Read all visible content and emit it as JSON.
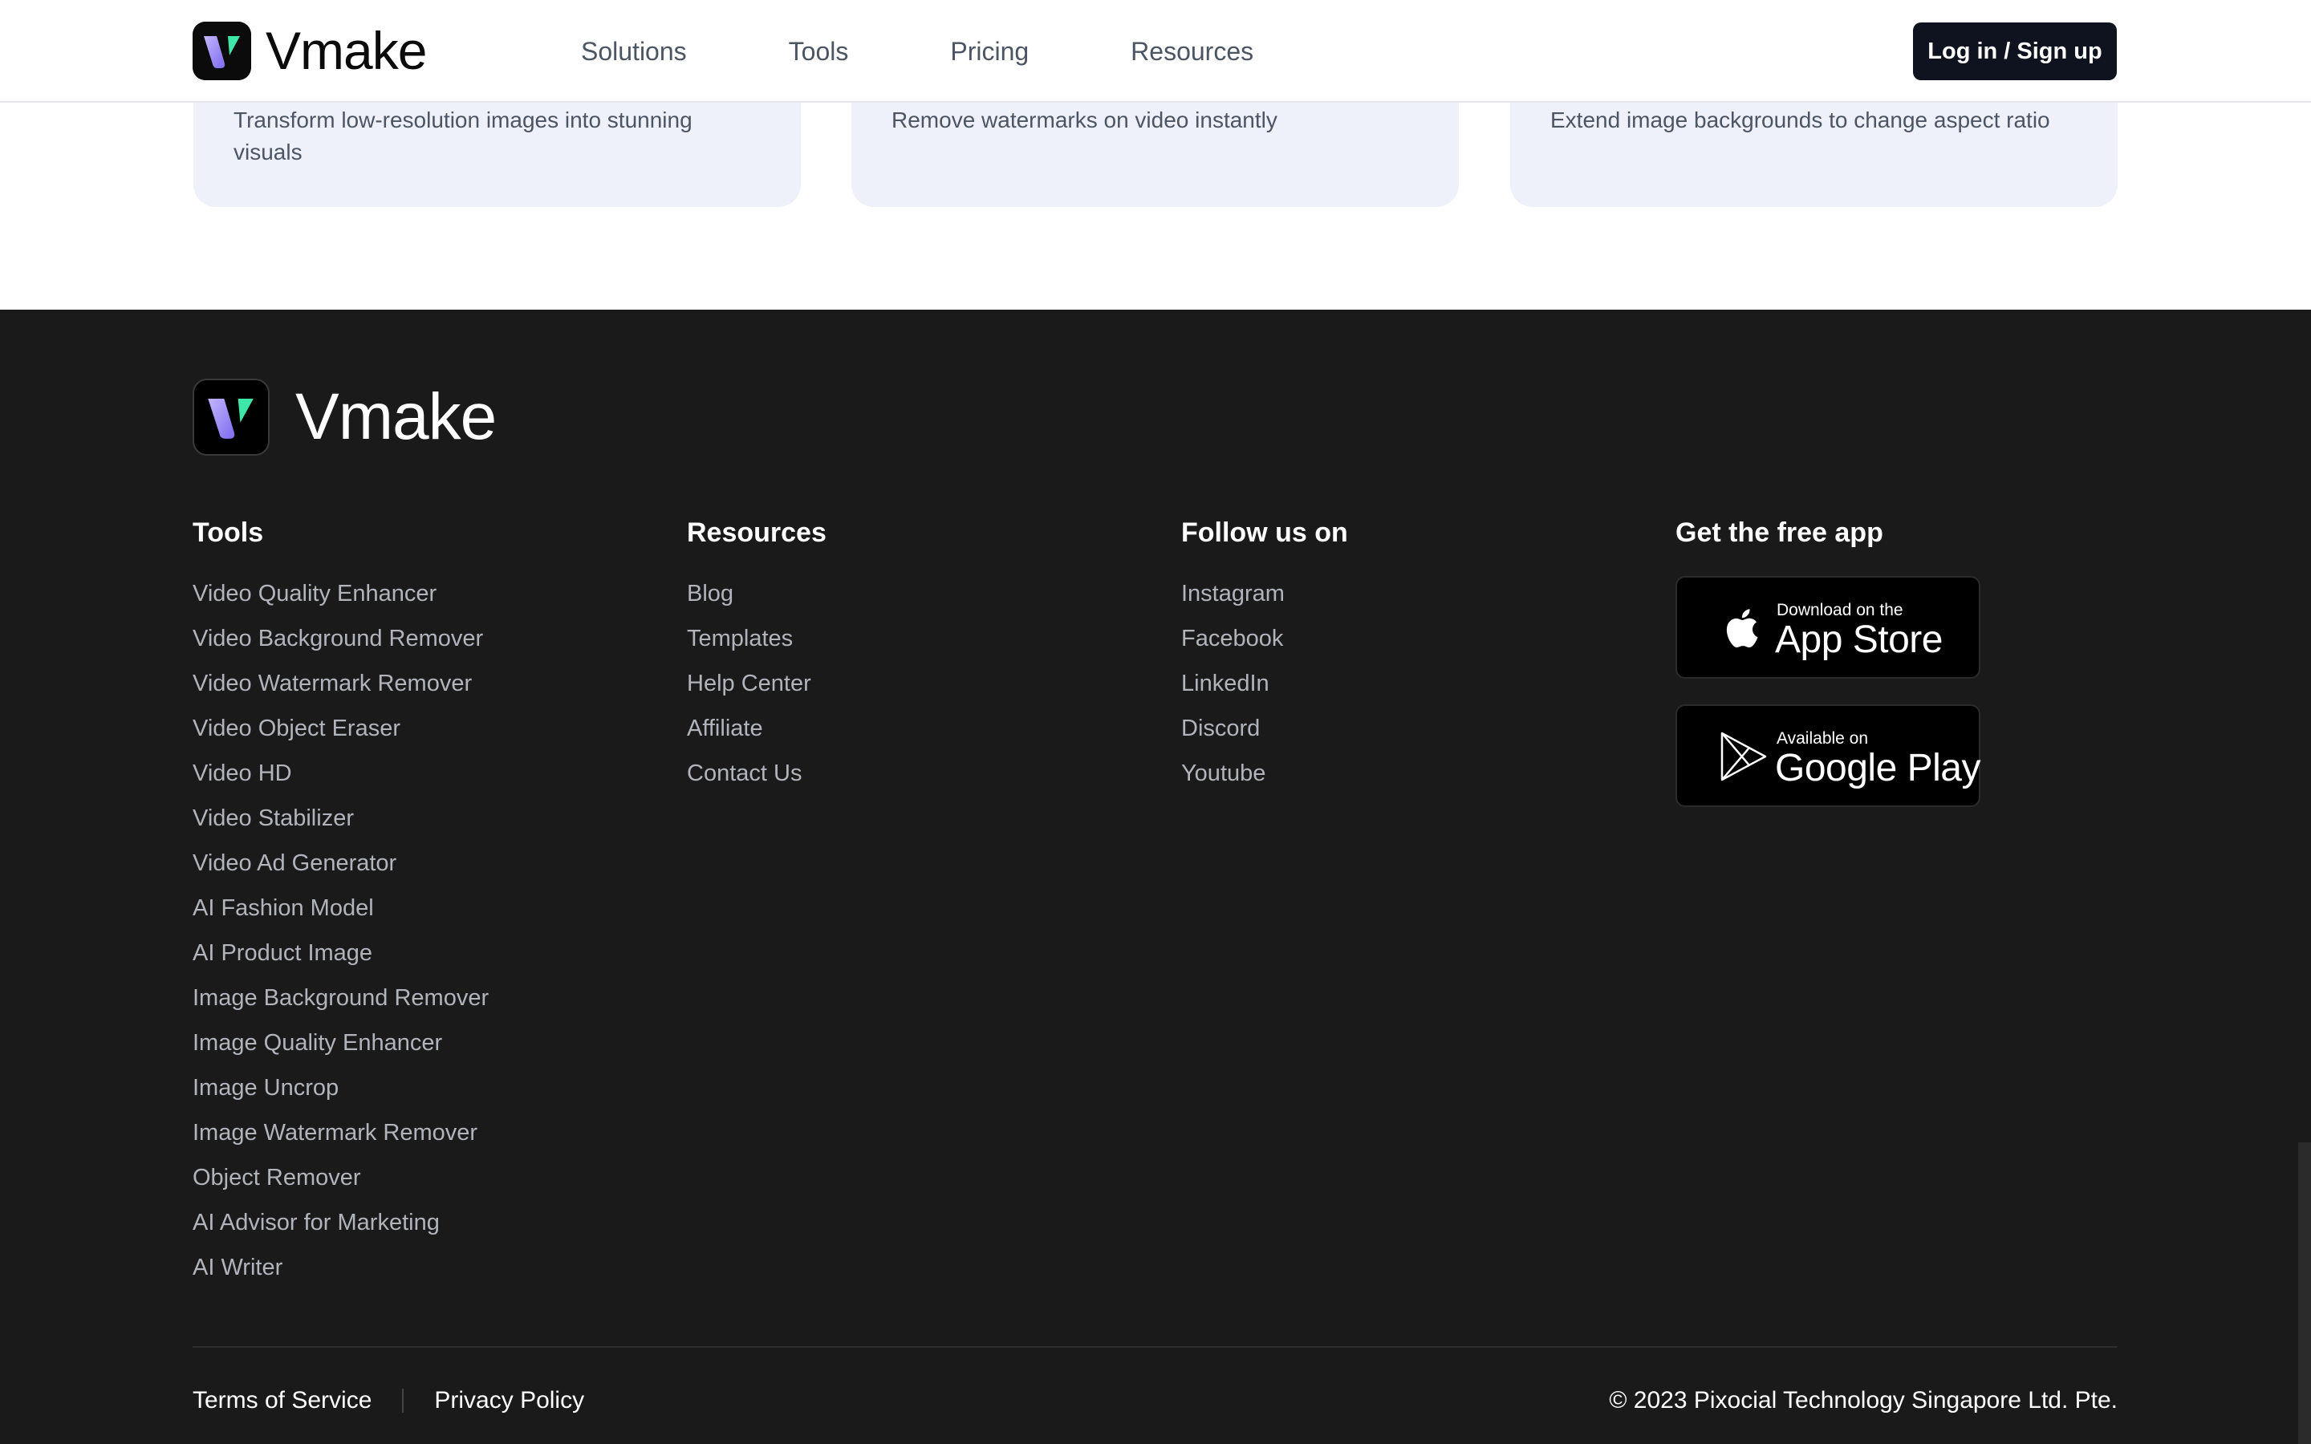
{
  "brand": {
    "name": "Vmake",
    "colors": {
      "primary": "#0f1320",
      "footer_bg": "#1a1a1a",
      "card_bg": "#eef1f9",
      "logo_green": "#3ee6a8",
      "logo_purple": "#8b7cf6"
    }
  },
  "header": {
    "nav": [
      "Solutions",
      "Tools",
      "Pricing",
      "Resources"
    ],
    "login_label": "Log in / Sign up"
  },
  "cards": [
    {
      "description": "Transform low-resolution images into stunning visuals"
    },
    {
      "description": "Remove watermarks on video instantly"
    },
    {
      "description": "Extend image backgrounds to change aspect ratio"
    }
  ],
  "footer": {
    "columns": {
      "tools": {
        "title": "Tools",
        "links": [
          "Video Quality Enhancer",
          "Video Background Remover",
          "Video Watermark Remover",
          "Video Object Eraser",
          "Video HD",
          "Video Stabilizer",
          "Video Ad Generator",
          "AI Fashion Model",
          "AI Product Image",
          "Image Background Remover",
          "Image Quality Enhancer",
          "Image Uncrop",
          "Image Watermark Remover",
          "Object Remover",
          "AI Advisor for Marketing",
          "AI Writer"
        ]
      },
      "resources": {
        "title": "Resources",
        "links": [
          "Blog",
          "Templates",
          "Help Center",
          "Affiliate",
          "Contact Us"
        ]
      },
      "follow": {
        "title": "Follow us on",
        "links": [
          "Instagram",
          "Facebook",
          "LinkedIn",
          "Discord",
          "Youtube"
        ]
      },
      "app": {
        "title": "Get the free app",
        "app_store": {
          "small": "Download on the",
          "big": "App Store",
          "icon": "apple-icon"
        },
        "google_play": {
          "small": "Available on",
          "big": "Google Play",
          "icon": "google-play-icon"
        }
      }
    },
    "legal": {
      "terms": "Terms of Service",
      "privacy": "Privacy Policy"
    },
    "copyright": "© 2023 Pixocial Technology Singapore Ltd. Pte."
  }
}
